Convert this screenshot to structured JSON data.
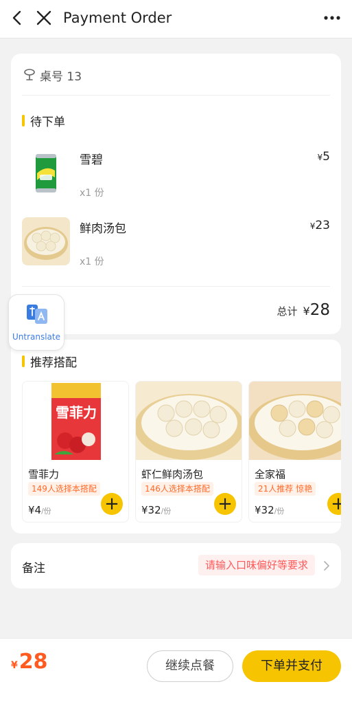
{
  "header": {
    "title": "Payment Order",
    "back_icon": "chevron-left-icon",
    "close_icon": "close-icon",
    "more_icon": "more-dots-icon"
  },
  "order": {
    "table_label": "桌号 13",
    "section_title": "待下单",
    "items": [
      {
        "name": "雪碧",
        "qty": "x1 份",
        "currency": "¥",
        "price": "5"
      },
      {
        "name": "鲜肉汤包",
        "qty": "x1 份",
        "currency": "¥",
        "price": "23"
      }
    ],
    "total_label": "总计",
    "total_currency": "¥",
    "total_value": "28"
  },
  "untranslate": {
    "label": "Untranslate"
  },
  "recommend": {
    "section_title": "推荐搭配",
    "items": [
      {
        "name": "雪菲力",
        "tag": "149人选择本搭配",
        "currency": "¥",
        "price": "4",
        "unit": "/份"
      },
      {
        "name": "虾仁鲜肉汤包",
        "tag": "146人选择本搭配",
        "currency": "¥",
        "price": "32",
        "unit": "/份"
      },
      {
        "name": "全家福",
        "tag": "21人推荐 惊艳",
        "currency": "¥",
        "price": "32",
        "unit": "/份"
      }
    ]
  },
  "note": {
    "label": "备注",
    "placeholder": "请输入口味偏好等要求"
  },
  "footer": {
    "currency": "¥",
    "total": "28",
    "continue_label": "继续点餐",
    "pay_label": "下单并支付"
  },
  "colors": {
    "accent": "#f6c400",
    "price_orange": "#ff5a1f",
    "tag_orange": "#ff6a2a",
    "background": "#f2f2f2"
  }
}
